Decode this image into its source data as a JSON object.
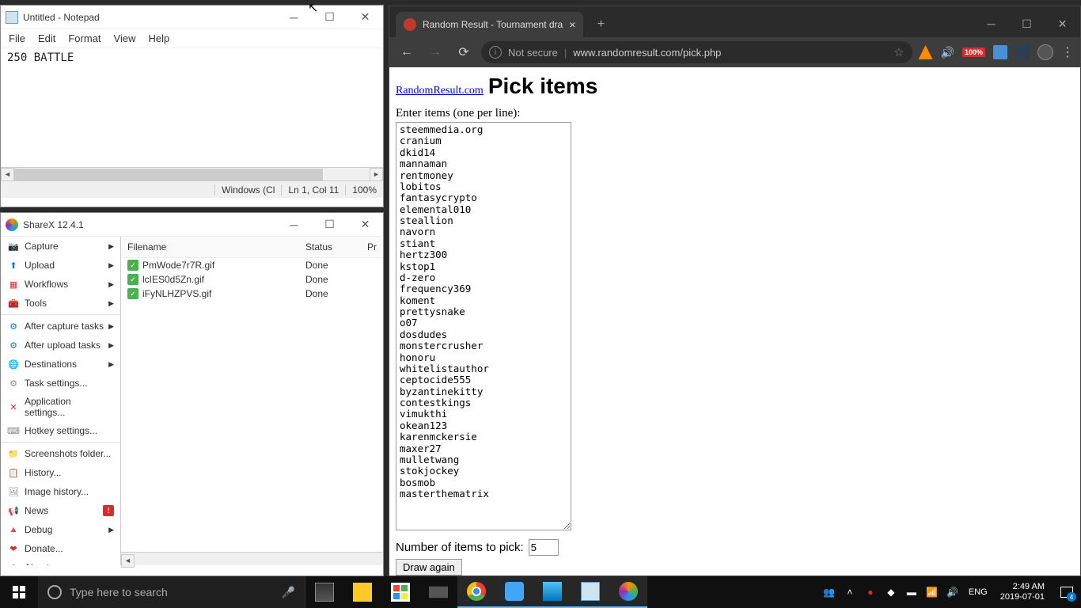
{
  "notepad": {
    "title": "Untitled - Notepad",
    "menu": [
      "File",
      "Edit",
      "Format",
      "View",
      "Help"
    ],
    "content": "250 BATTLE",
    "status": {
      "encoding": "Windows (Cl",
      "position": "Ln 1, Col 11",
      "zoom": "100%"
    }
  },
  "sharex": {
    "title": "ShareX 12.4.1",
    "sidebar": [
      {
        "icon": "📷",
        "label": "Capture",
        "arrow": true,
        "color": "#555"
      },
      {
        "icon": "⬆",
        "label": "Upload",
        "arrow": true,
        "color": "#1976d2"
      },
      {
        "icon": "▦",
        "label": "Workflows",
        "arrow": true,
        "color": "#d32f2f"
      },
      {
        "icon": "🧰",
        "label": "Tools",
        "arrow": true,
        "color": "#d32f2f"
      },
      {
        "divider": true
      },
      {
        "icon": "⚙",
        "label": "After capture tasks",
        "arrow": true,
        "color": "#1976d2"
      },
      {
        "icon": "⚙",
        "label": "After upload tasks",
        "arrow": true,
        "color": "#1976d2"
      },
      {
        "icon": "🌐",
        "label": "Destinations",
        "arrow": true,
        "color": "#1976d2"
      },
      {
        "icon": "⚙",
        "label": "Task settings...",
        "color": "#888"
      },
      {
        "icon": "✕",
        "label": "Application settings...",
        "color": "#d32f2f"
      },
      {
        "icon": "⌨",
        "label": "Hotkey settings...",
        "color": "#888"
      },
      {
        "divider": true
      },
      {
        "icon": "📁",
        "label": "Screenshots folder...",
        "color": "#f9a825"
      },
      {
        "icon": "📋",
        "label": "History...",
        "color": "#1976d2"
      },
      {
        "icon": "🖼",
        "label": "Image history...",
        "color": "#888"
      },
      {
        "icon": "📢",
        "label": "News",
        "badge": "!",
        "color": "#d32f2f"
      },
      {
        "icon": "🔺",
        "label": "Debug",
        "arrow": true,
        "color": "#f9a825"
      },
      {
        "icon": "❤",
        "label": "Donate...",
        "color": "#d32f2f"
      },
      {
        "icon": "ℹ",
        "label": "About...",
        "color": "#888"
      }
    ],
    "columns": {
      "filename": "Filename",
      "status": "Status",
      "extra": "Pr"
    },
    "rows": [
      {
        "filename": "PmWode7r7R.gif",
        "status": "Done"
      },
      {
        "filename": "lcIES0d5Zn.gif",
        "status": "Done"
      },
      {
        "filename": "iFyNLHZPVS.gif",
        "status": "Done"
      }
    ]
  },
  "chrome": {
    "tab_title": "Random Result - Tournament dra",
    "url_secure": "Not secure",
    "url": "www.randomresult.com/pick.php",
    "ext_badge": "100%",
    "page": {
      "site_link": "RandomResult.com",
      "heading": "Pick items",
      "enter_label": "Enter items (one per line):",
      "items": "steemmedia.org\ncranium\ndkid14\nmannaman\nrentmoney\nlobitos\nfantasycrypto\nelemental010\nsteallion\nnavorn\nstiant\nhertz300\nkstop1\nd-zero\nfrequency369\nkoment\nprettysnake\no07\ndosdudes\nmonstercrusher\nhonoru\nwhitelistauthor\nceptocide555\nbyzantinekitty\ncontestkings\nvimukthi\nokean123\nkarenmckersie\nmaxer27\nmulletwang\nstokjockey\nbosmob\nmasterthematrix",
      "num_label": "Number of items to pick:",
      "num_value": "5",
      "draw_btn": "Draw again"
    }
  },
  "taskbar": {
    "search_placeholder": "Type here to search",
    "lang": "ENG",
    "time": "2:49 AM",
    "date": "2019-07-01",
    "notif_count": "4"
  }
}
